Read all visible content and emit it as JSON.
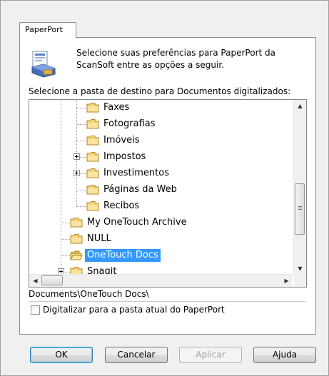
{
  "tab": {
    "label": "PaperPort"
  },
  "intro_text": "Selecione suas preferências para PaperPort da ScanSoft entre as opções a seguir.",
  "dest_label": "Selecione a pasta de destino para Documentos digitalizados:",
  "tree": {
    "items": [
      {
        "label": "Faxes",
        "level": 2,
        "expandable": false,
        "selected": false,
        "open": false
      },
      {
        "label": "Fotografias",
        "level": 2,
        "expandable": false,
        "selected": false,
        "open": false
      },
      {
        "label": "Imóveis",
        "level": 2,
        "expandable": false,
        "selected": false,
        "open": false
      },
      {
        "label": "Impostos",
        "level": 2,
        "expandable": true,
        "selected": false,
        "open": false
      },
      {
        "label": "Investimentos",
        "level": 2,
        "expandable": true,
        "selected": false,
        "open": false
      },
      {
        "label": "Páginas da Web",
        "level": 2,
        "expandable": false,
        "selected": false,
        "open": false
      },
      {
        "label": "Recibos",
        "level": 2,
        "expandable": false,
        "selected": false,
        "open": false
      },
      {
        "label": "My OneTouch Archive",
        "level": 1,
        "expandable": false,
        "selected": false,
        "open": false
      },
      {
        "label": "NULL",
        "level": 1,
        "expandable": false,
        "selected": false,
        "open": false
      },
      {
        "label": "OneTouch Docs",
        "level": 1,
        "expandable": false,
        "selected": true,
        "open": true
      },
      {
        "label": "Snagit",
        "level": 1,
        "expandable": true,
        "selected": false,
        "open": false
      }
    ]
  },
  "path_value": "Documents\\OneTouch Docs\\",
  "checkbox": {
    "label": "Digitalizar para a pasta atual do PaperPort",
    "checked": false
  },
  "buttons": {
    "ok": "OK",
    "cancel": "Cancelar",
    "apply": "Aplicar",
    "help": "Ajuda"
  },
  "icons": {
    "scroll_up": "▲",
    "scroll_down": "▼",
    "scroll_left": "◀",
    "scroll_right": "▶"
  },
  "colors": {
    "selection": "#3399ff",
    "folder": "#f5d67a"
  }
}
